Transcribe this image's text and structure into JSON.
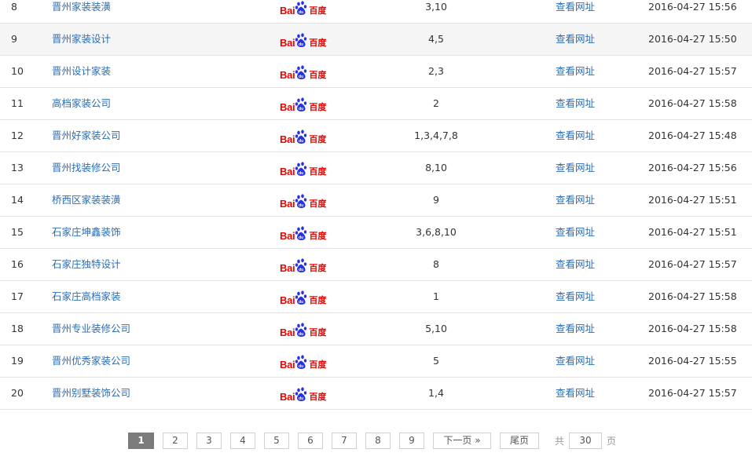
{
  "rows": [
    {
      "num": "8",
      "keyword": "晋州家装装潢",
      "engine": "baidu",
      "rank": "3,10",
      "link": "查看网址",
      "time": "2016-04-27 15:56"
    },
    {
      "num": "9",
      "keyword": "晋州家装设计",
      "engine": "baidu",
      "rank": "4,5",
      "link": "查看网址",
      "time": "2016-04-27 15:50"
    },
    {
      "num": "10",
      "keyword": "晋州设计家装",
      "engine": "baidu",
      "rank": "2,3",
      "link": "查看网址",
      "time": "2016-04-27 15:57"
    },
    {
      "num": "11",
      "keyword": "高档家装公司",
      "engine": "baidu",
      "rank": "2",
      "link": "查看网址",
      "time": "2016-04-27 15:58"
    },
    {
      "num": "12",
      "keyword": "晋州好家装公司",
      "engine": "baidu",
      "rank": "1,3,4,7,8",
      "link": "查看网址",
      "time": "2016-04-27 15:48"
    },
    {
      "num": "13",
      "keyword": "晋州找装修公司",
      "engine": "baidu",
      "rank": "8,10",
      "link": "查看网址",
      "time": "2016-04-27 15:56"
    },
    {
      "num": "14",
      "keyword": "桥西区家装装潢",
      "engine": "baidu",
      "rank": "9",
      "link": "查看网址",
      "time": "2016-04-27 15:51"
    },
    {
      "num": "15",
      "keyword": "石家庄坤鑫装饰",
      "engine": "baidu",
      "rank": "3,6,8,10",
      "link": "查看网址",
      "time": "2016-04-27 15:51"
    },
    {
      "num": "16",
      "keyword": "石家庄独特设计",
      "engine": "baidu",
      "rank": "8",
      "link": "查看网址",
      "time": "2016-04-27 15:57"
    },
    {
      "num": "17",
      "keyword": "石家庄高档家装",
      "engine": "baidu",
      "rank": "1",
      "link": "查看网址",
      "time": "2016-04-27 15:58"
    },
    {
      "num": "18",
      "keyword": "晋州专业装修公司",
      "engine": "baidu",
      "rank": "5,10",
      "link": "查看网址",
      "time": "2016-04-27 15:58"
    },
    {
      "num": "19",
      "keyword": "晋州优秀家装公司",
      "engine": "baidu",
      "rank": "5",
      "link": "查看网址",
      "time": "2016-04-27 15:55"
    },
    {
      "num": "20",
      "keyword": "晋州别墅装饰公司",
      "engine": "baidu",
      "rank": "1,4",
      "link": "查看网址",
      "time": "2016-04-27 15:57"
    }
  ],
  "engine_logo": {
    "text_left": "Bai",
    "text_right": "百度",
    "icon": "baidu-paw-icon",
    "color": "#e10602"
  },
  "pagination": {
    "current": "1",
    "pages": [
      "2",
      "3",
      "4",
      "5",
      "6",
      "7",
      "8",
      "9"
    ],
    "next_label": "下一页 »",
    "last_label": "尾页",
    "total_prefix": "共",
    "total_pages": "30",
    "total_suffix": "页"
  },
  "colors": {
    "link": "#2a6db5",
    "current_page_bg": "#7b7b7b",
    "row_highlight": "#f5f5f5"
  }
}
